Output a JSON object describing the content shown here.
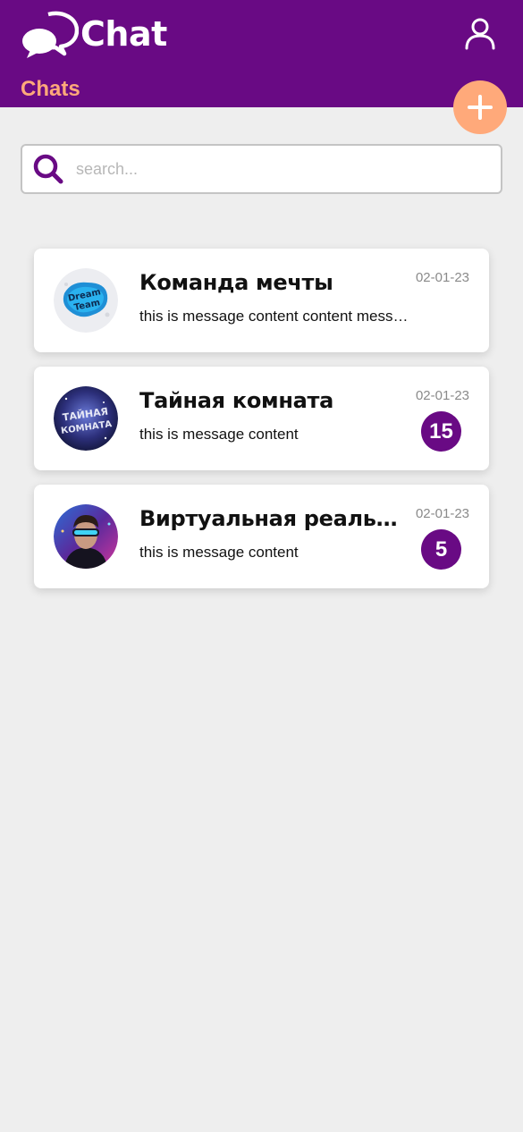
{
  "app": {
    "title": "Chat",
    "section_title": "Chats",
    "colors": {
      "primary": "#690a84",
      "accent": "#ffa97a",
      "background": "#eeeeee"
    }
  },
  "icons": {
    "logo": "chat-bubbles-icon",
    "user": "user-icon",
    "add": "plus-icon",
    "search": "search-icon"
  },
  "search": {
    "placeholder": "search...",
    "value": ""
  },
  "chats": [
    {
      "name": "Команда мечты",
      "message": "this is message content content message content",
      "date": "02-01-23",
      "unread": "",
      "avatar_text": [
        "Dream",
        "Team"
      ]
    },
    {
      "name": "Тайная комната",
      "message": "this is message content",
      "date": "02-01-23",
      "unread": "15",
      "avatar_text": [
        "ТАЙНАЯ",
        "КОМНАТА"
      ]
    },
    {
      "name": "Виртуальная реальность",
      "message": "this is message content",
      "date": "02-01-23",
      "unread": "5",
      "avatar_text": []
    }
  ]
}
